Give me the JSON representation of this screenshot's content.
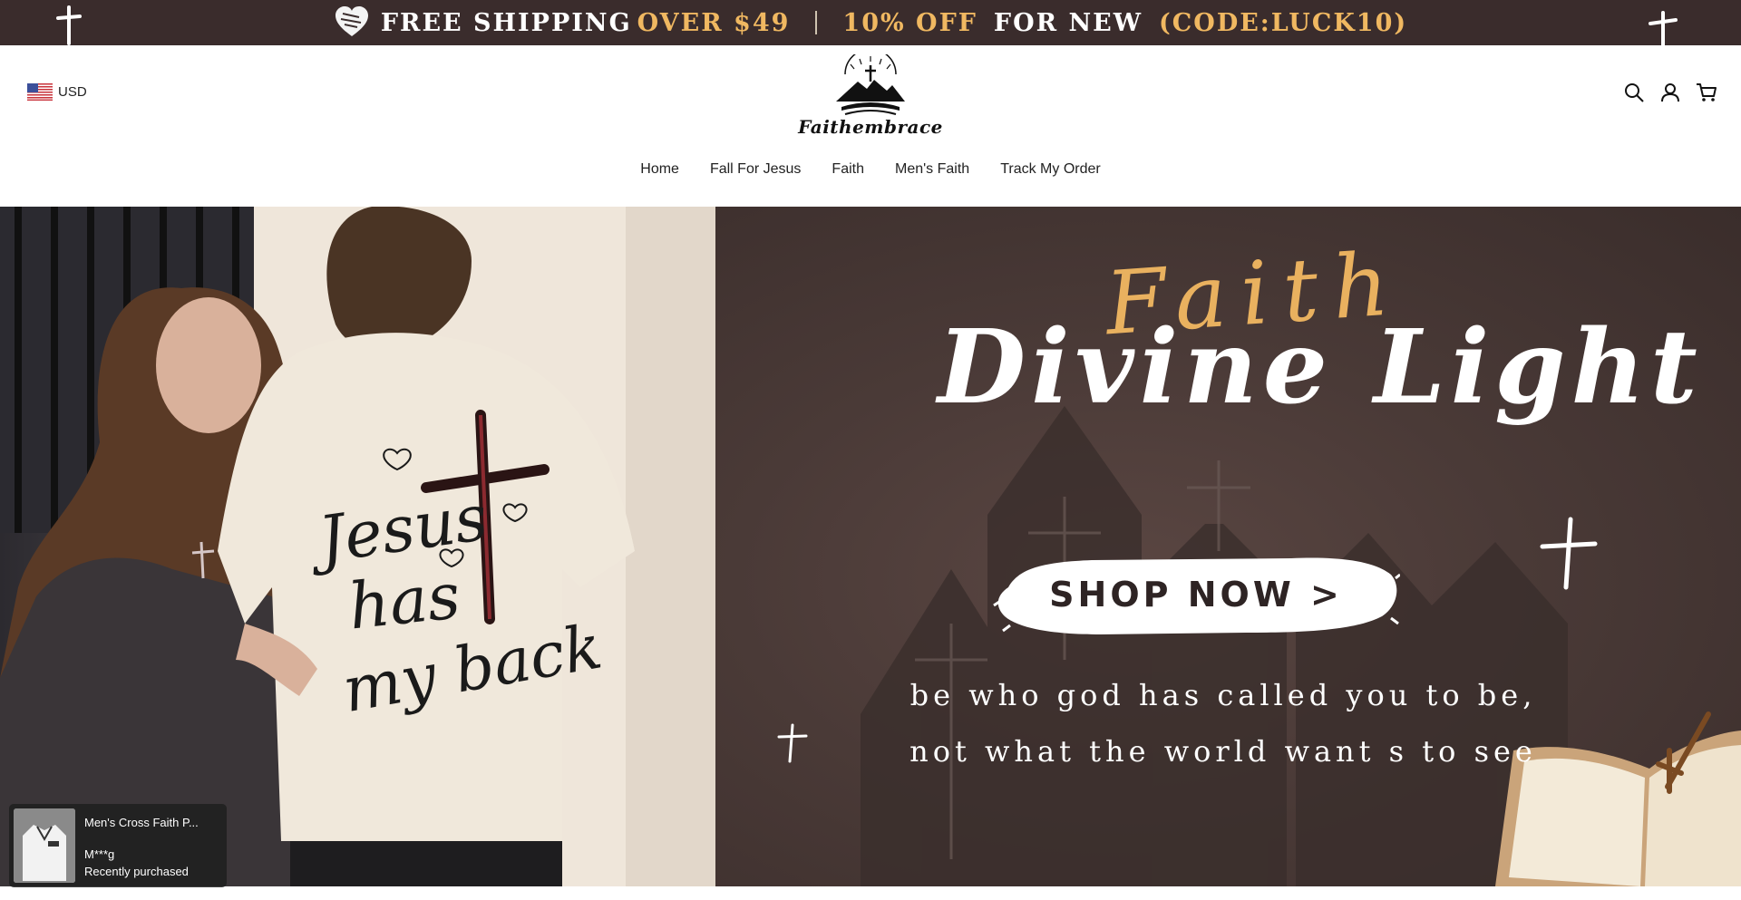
{
  "announcement": {
    "free_shipping": "FREE SHIPPING",
    "over_amount": "OVER $49",
    "discount": "10% OFF",
    "for_new": "FOR NEW",
    "code": "(CODE:LUCK10)",
    "icons": [
      "heart-icon",
      "cross-icon"
    ]
  },
  "header": {
    "currency": "USD",
    "brand": "Faithembrace",
    "icons": [
      "search-icon",
      "account-icon",
      "cart-icon"
    ]
  },
  "nav": {
    "items": [
      {
        "label": "Home"
      },
      {
        "label": "Fall For Jesus"
      },
      {
        "label": "Faith"
      },
      {
        "label": "Men's Faith"
      },
      {
        "label": "Track My Order"
      }
    ]
  },
  "hero": {
    "shirt_text": [
      "Jesus",
      "has",
      "my back"
    ],
    "faith_script": "Faith",
    "headline": "Divine Light",
    "cta": "SHOP NOW >",
    "quote_line1": "be who god has called you to be,",
    "quote_line2": "not what the world want s to see"
  },
  "popup": {
    "product_name": "Men's Cross Faith P...",
    "buyer": "M***g",
    "status": "Recently purchased"
  },
  "colors": {
    "announce_bg": "#3a2c2c",
    "gold": "#f0b861",
    "hero_right_bg": "#4a3a37"
  }
}
